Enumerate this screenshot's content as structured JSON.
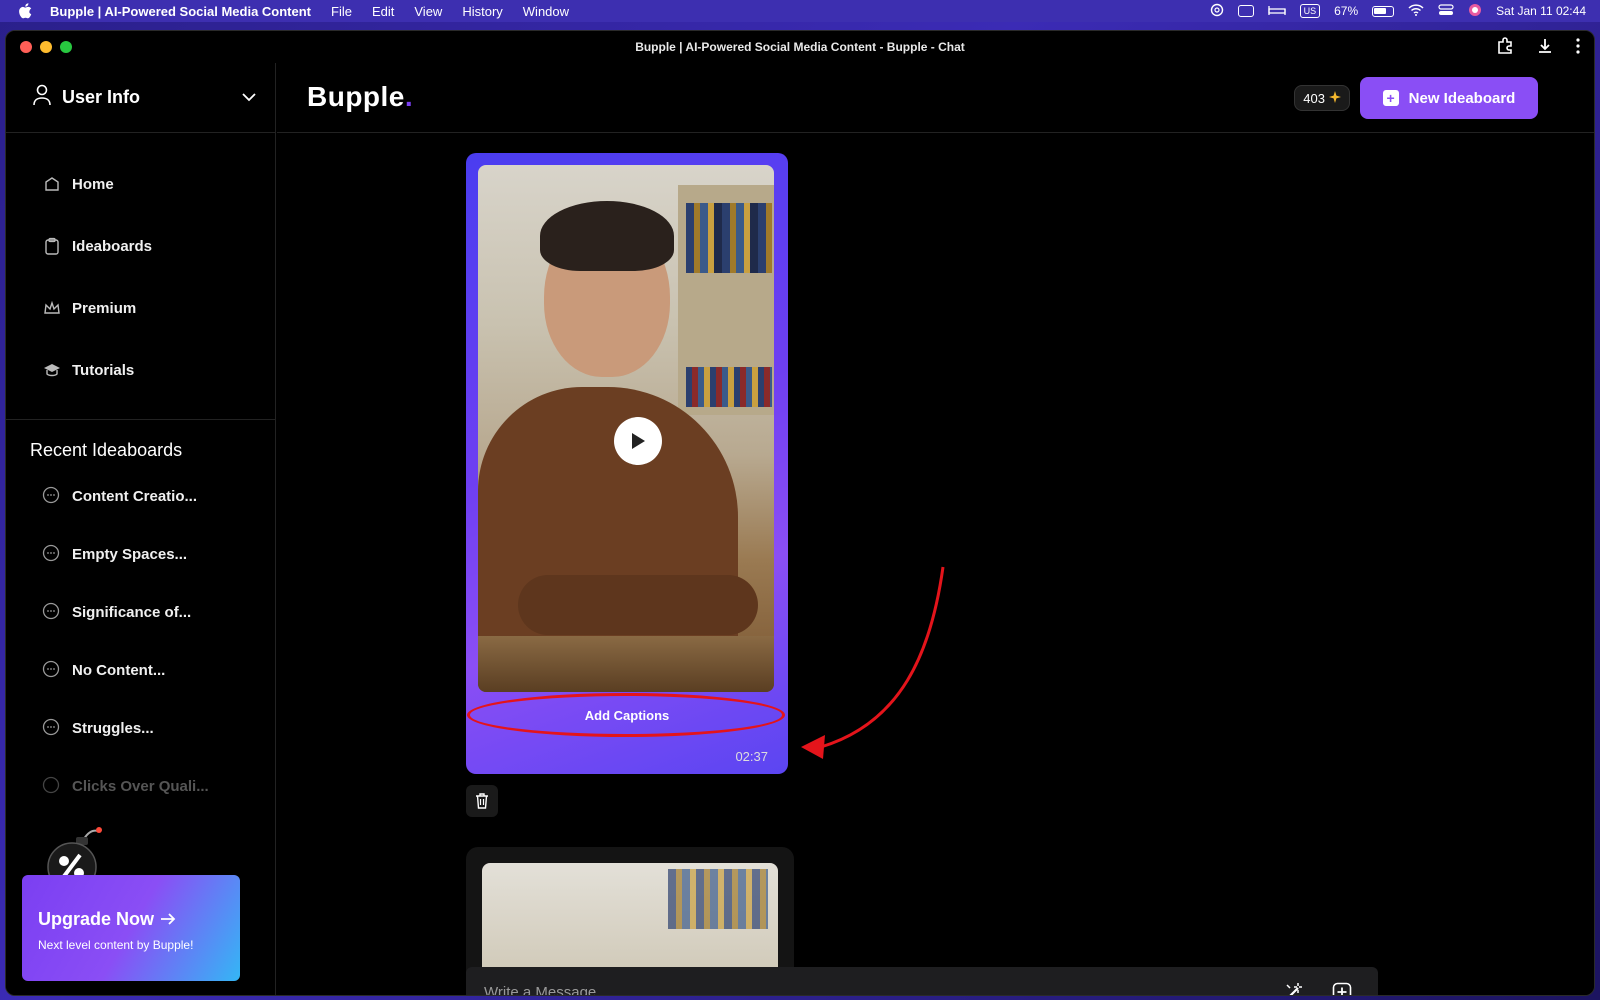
{
  "menubar": {
    "app_name": "Bupple | AI-Powered Social Media Content",
    "menus": [
      "File",
      "Edit",
      "View",
      "History",
      "Window"
    ],
    "keyboard": "US",
    "battery": "67%",
    "datetime": "Sat Jan 11  02:44"
  },
  "window": {
    "title": "Bupple | AI-Powered Social Media Content - Bupple - Chat"
  },
  "sidebar": {
    "user_label": "User Info",
    "nav": [
      {
        "label": "Home",
        "icon": "home-icon"
      },
      {
        "label": "Ideaboards",
        "icon": "clipboard-icon"
      },
      {
        "label": "Premium",
        "icon": "crown-icon"
      },
      {
        "label": "Tutorials",
        "icon": "graduation-cap-icon"
      }
    ],
    "recent_title": "Recent Ideaboards",
    "recent": [
      "Content Creatio...",
      "Empty Spaces...",
      "Significance of...",
      "No Content...",
      "Struggles...",
      "Clicks Over Quali..."
    ],
    "upgrade": {
      "title": "Upgrade Now",
      "subtitle": "Next level content by Bupple!"
    }
  },
  "header": {
    "logo": "Bupple",
    "logo_dot": ".",
    "credits": "403",
    "new_ideaboard": "New Ideaboard"
  },
  "video": {
    "add_captions": "Add Captions",
    "duration": "02:37"
  },
  "composer": {
    "placeholder": "Write a Message ..."
  },
  "colors": {
    "accent": "#8a4ef5",
    "annotation": "#e4141b"
  }
}
